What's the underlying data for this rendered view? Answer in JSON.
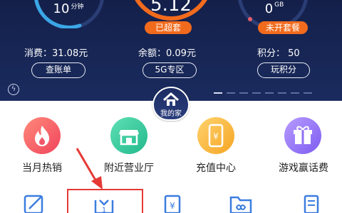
{
  "gauges": {
    "left": {
      "value": "10",
      "unit": "分钟"
    },
    "center": {
      "value": "5.12",
      "tag": "已超套"
    },
    "right": {
      "value": "0",
      "unit": "GB",
      "tag": "未开套餐"
    }
  },
  "stats": {
    "consumption": "消费：31.08元",
    "balance": "余额：0.09元",
    "points": "积分：  50"
  },
  "actions": {
    "bill": "查账单",
    "zone5g": "5G专区",
    "play_points": "玩积分"
  },
  "home": {
    "label": "我的家"
  },
  "menu": [
    {
      "label": "当月热销",
      "icon": "flame-icon"
    },
    {
      "label": "附近营业厅",
      "icon": "store-icon"
    },
    {
      "label": "充值中心",
      "icon": "phone-yuan-icon"
    },
    {
      "label": "游戏赢话费",
      "icon": "gift-icon"
    }
  ],
  "colors": {
    "header_bg": "#14204a",
    "accent_orange": "#f26b1d",
    "highlight_red": "#e53935",
    "icon_blue": "#3b7de0"
  }
}
